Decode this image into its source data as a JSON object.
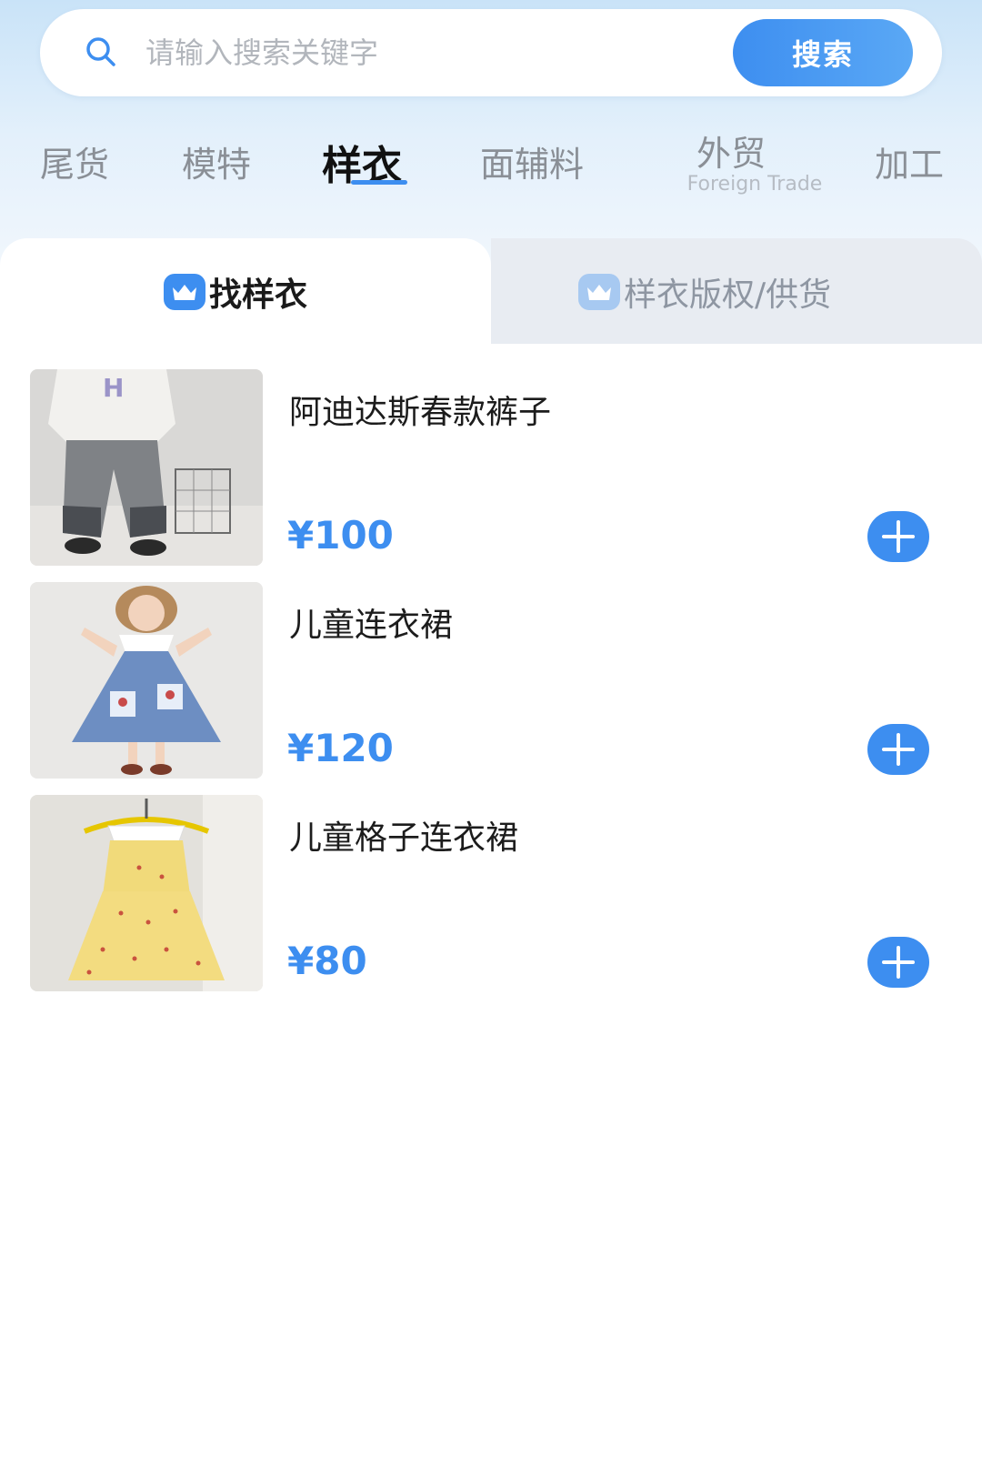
{
  "search": {
    "placeholder": "请输入搜索关键字",
    "button_label": "搜索"
  },
  "categories": [
    {
      "label": "尾货"
    },
    {
      "label": "模特"
    },
    {
      "label": "样衣",
      "active": true
    },
    {
      "label": "面辅料"
    },
    {
      "label": "外贸",
      "sub": "Foreign Trade"
    },
    {
      "label": "加工"
    }
  ],
  "tabs": [
    {
      "label": "找样衣",
      "active": true
    },
    {
      "label": "样衣版权/供货",
      "active": false
    }
  ],
  "products": [
    {
      "name": "阿迪达斯春款裤子",
      "price": "¥100"
    },
    {
      "name": "儿童连衣裙",
      "price": "¥120"
    },
    {
      "name": "儿童格子连衣裙",
      "price": "¥80"
    }
  ],
  "colors": {
    "accent": "#3d8ef0",
    "header_bg": "#c9e3f8",
    "inactive_tab_bg": "#e8ecf2"
  }
}
